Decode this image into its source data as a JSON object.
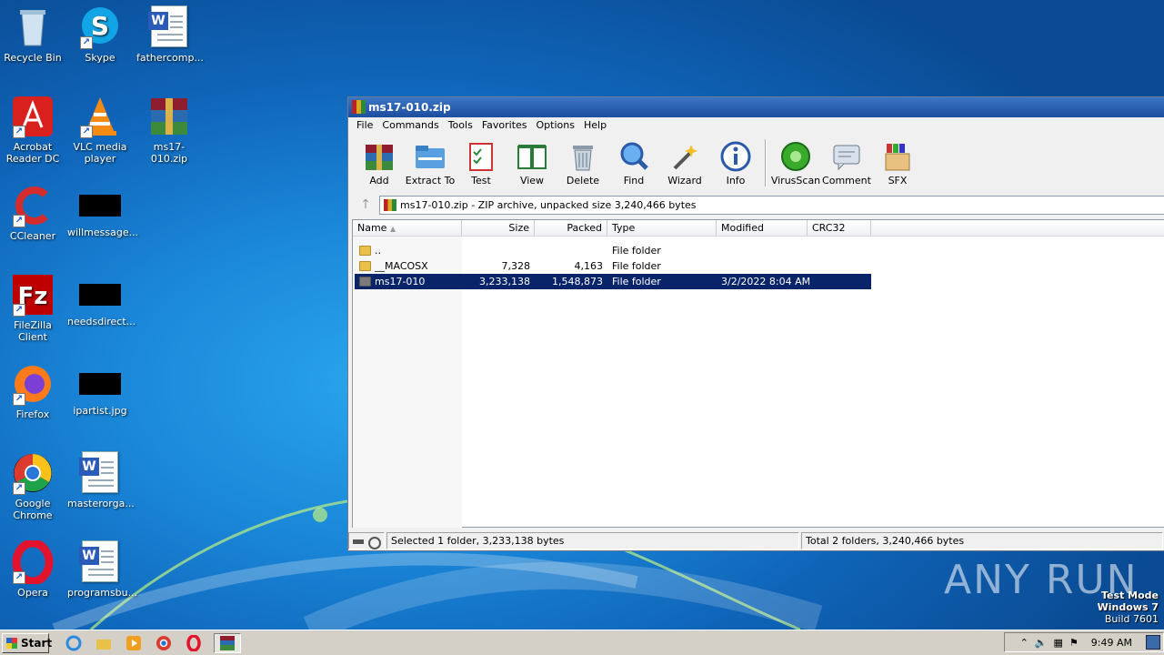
{
  "desktop": {
    "icons": [
      {
        "label": "Recycle Bin"
      },
      {
        "label": "Skype"
      },
      {
        "label": "fathercomp..."
      },
      {
        "label": "Acrobat Reader DC"
      },
      {
        "label": "VLC media player"
      },
      {
        "label": "ms17-010.zip"
      },
      {
        "label": "CCleaner"
      },
      {
        "label": "willmessage..."
      },
      {
        "label": "FileZilla Client"
      },
      {
        "label": "needsdirect..."
      },
      {
        "label": "Firefox"
      },
      {
        "label": "ipartist.jpg"
      },
      {
        "label": "Google Chrome"
      },
      {
        "label": "masterorga..."
      },
      {
        "label": "Opera"
      },
      {
        "label": "programsbu..."
      }
    ]
  },
  "window": {
    "title": "ms17-010.zip",
    "menu": [
      "File",
      "Commands",
      "Tools",
      "Favorites",
      "Options",
      "Help"
    ],
    "toolbar": [
      {
        "label": "Add",
        "icon": "add-icon"
      },
      {
        "label": "Extract To",
        "icon": "extract-icon"
      },
      {
        "label": "Test",
        "icon": "test-icon"
      },
      {
        "label": "View",
        "icon": "view-icon"
      },
      {
        "label": "Delete",
        "icon": "delete-icon"
      },
      {
        "label": "Find",
        "icon": "find-icon"
      },
      {
        "label": "Wizard",
        "icon": "wizard-icon"
      },
      {
        "label": "Info",
        "icon": "info-icon"
      },
      {
        "label": "VirusScan",
        "icon": "virusscan-icon"
      },
      {
        "label": "Comment",
        "icon": "comment-icon"
      },
      {
        "label": "SFX",
        "icon": "sfx-icon"
      }
    ],
    "address": "ms17-010.zip - ZIP archive, unpacked size 3,240,466 bytes",
    "columns": [
      "Name",
      "Size",
      "Packed",
      "Type",
      "Modified",
      "CRC32"
    ],
    "rows": [
      {
        "name": "..",
        "size": "",
        "packed": "",
        "type": "File folder",
        "modified": "",
        "crc": ""
      },
      {
        "name": "__MACOSX",
        "size": "7,328",
        "packed": "4,163",
        "type": "File folder",
        "modified": "",
        "crc": ""
      },
      {
        "name": "ms17-010",
        "size": "3,233,138",
        "packed": "1,548,873",
        "type": "File folder",
        "modified": "3/2/2022 8:04 AM",
        "crc": "",
        "selected": true
      }
    ],
    "status_left": "Selected 1 folder, 3,233,138 bytes",
    "status_right": "Total 2 folders, 3,240,466 bytes"
  },
  "watermark": "ANY RUN",
  "testmode": {
    "line1": "Test Mode",
    "line2": "Windows 7",
    "line3": "Build 7601"
  },
  "taskbar": {
    "start": "Start",
    "clock": "9:49 AM"
  },
  "colors": {
    "selection": "#0a246a",
    "titlebar": "#1d4d9e",
    "desktop": "#1a86d8"
  }
}
